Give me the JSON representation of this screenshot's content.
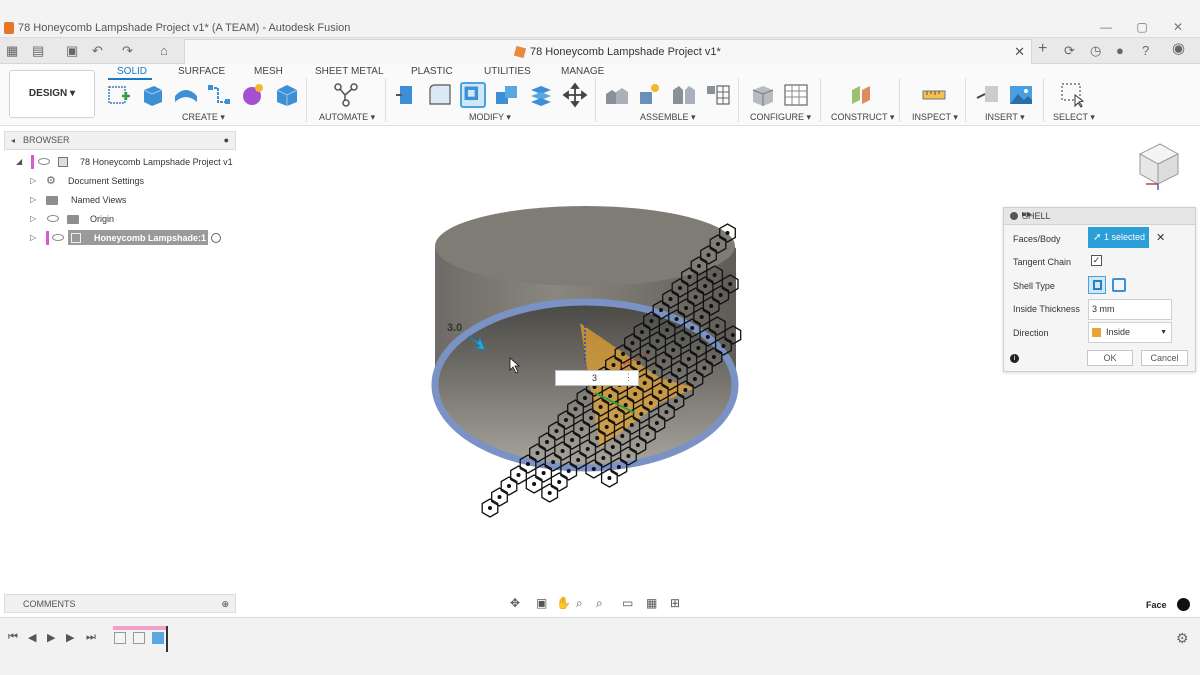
{
  "window": {
    "title": "78 Honeycomb Lampshade Project v1* (A TEAM) - Autodesk Fusion",
    "minimize": "—",
    "maximize": "▢",
    "close": "✕"
  },
  "doc_tab": {
    "title": "78 Honeycomb Lampshade Project v1*",
    "close": "✕"
  },
  "quick_access": {
    "grid": "▦",
    "file": "▤",
    "save": "▣",
    "undo": "↶",
    "redo": "↷",
    "home": "⌂",
    "add": "+",
    "extensions": "⟳",
    "jobs": "◷",
    "notifications": "●",
    "help": "?",
    "user": "◉"
  },
  "toolbar": {
    "design_label": "DESIGN ▾",
    "tabs": [
      "SOLID",
      "SURFACE",
      "MESH",
      "SHEET METAL",
      "PLASTIC",
      "UTILITIES",
      "MANAGE"
    ],
    "groups": [
      "CREATE ▾",
      "AUTOMATE ▾",
      "MODIFY ▾",
      "ASSEMBLE ▾",
      "CONFIGURE ▾",
      "CONSTRUCT ▾",
      "INSPECT ▾",
      "INSERT ▾",
      "SELECT ▾"
    ]
  },
  "browser": {
    "header": "BROWSER",
    "items": [
      {
        "label": "78 Honeycomb Lampshade Project v1"
      },
      {
        "label": "Document Settings"
      },
      {
        "label": "Named Views"
      },
      {
        "label": "Origin"
      },
      {
        "label": "Honeycomb Lampshade:1"
      }
    ]
  },
  "comments": {
    "header": "COMMENTS"
  },
  "shell": {
    "title": "SHELL",
    "rows": {
      "faces_body": "Faces/Body",
      "tangent_chain": "Tangent Chain",
      "shell_type": "Shell Type",
      "inside_thickness": "Inside Thickness",
      "direction": "Direction"
    },
    "selected": "1 selected",
    "clear": "✕",
    "thickness_value": "3 mm",
    "direction_value": "Inside",
    "ok": "OK",
    "cancel": "Cancel",
    "info": "i"
  },
  "viewport": {
    "dim_label": "3.0",
    "dim_input": "3",
    "selection_type": "Face"
  },
  "colors": {
    "accent": "#2a9fd8",
    "cylinder": "#807d77",
    "rim": "#7b93c4",
    "arrow": "#e8a531"
  }
}
